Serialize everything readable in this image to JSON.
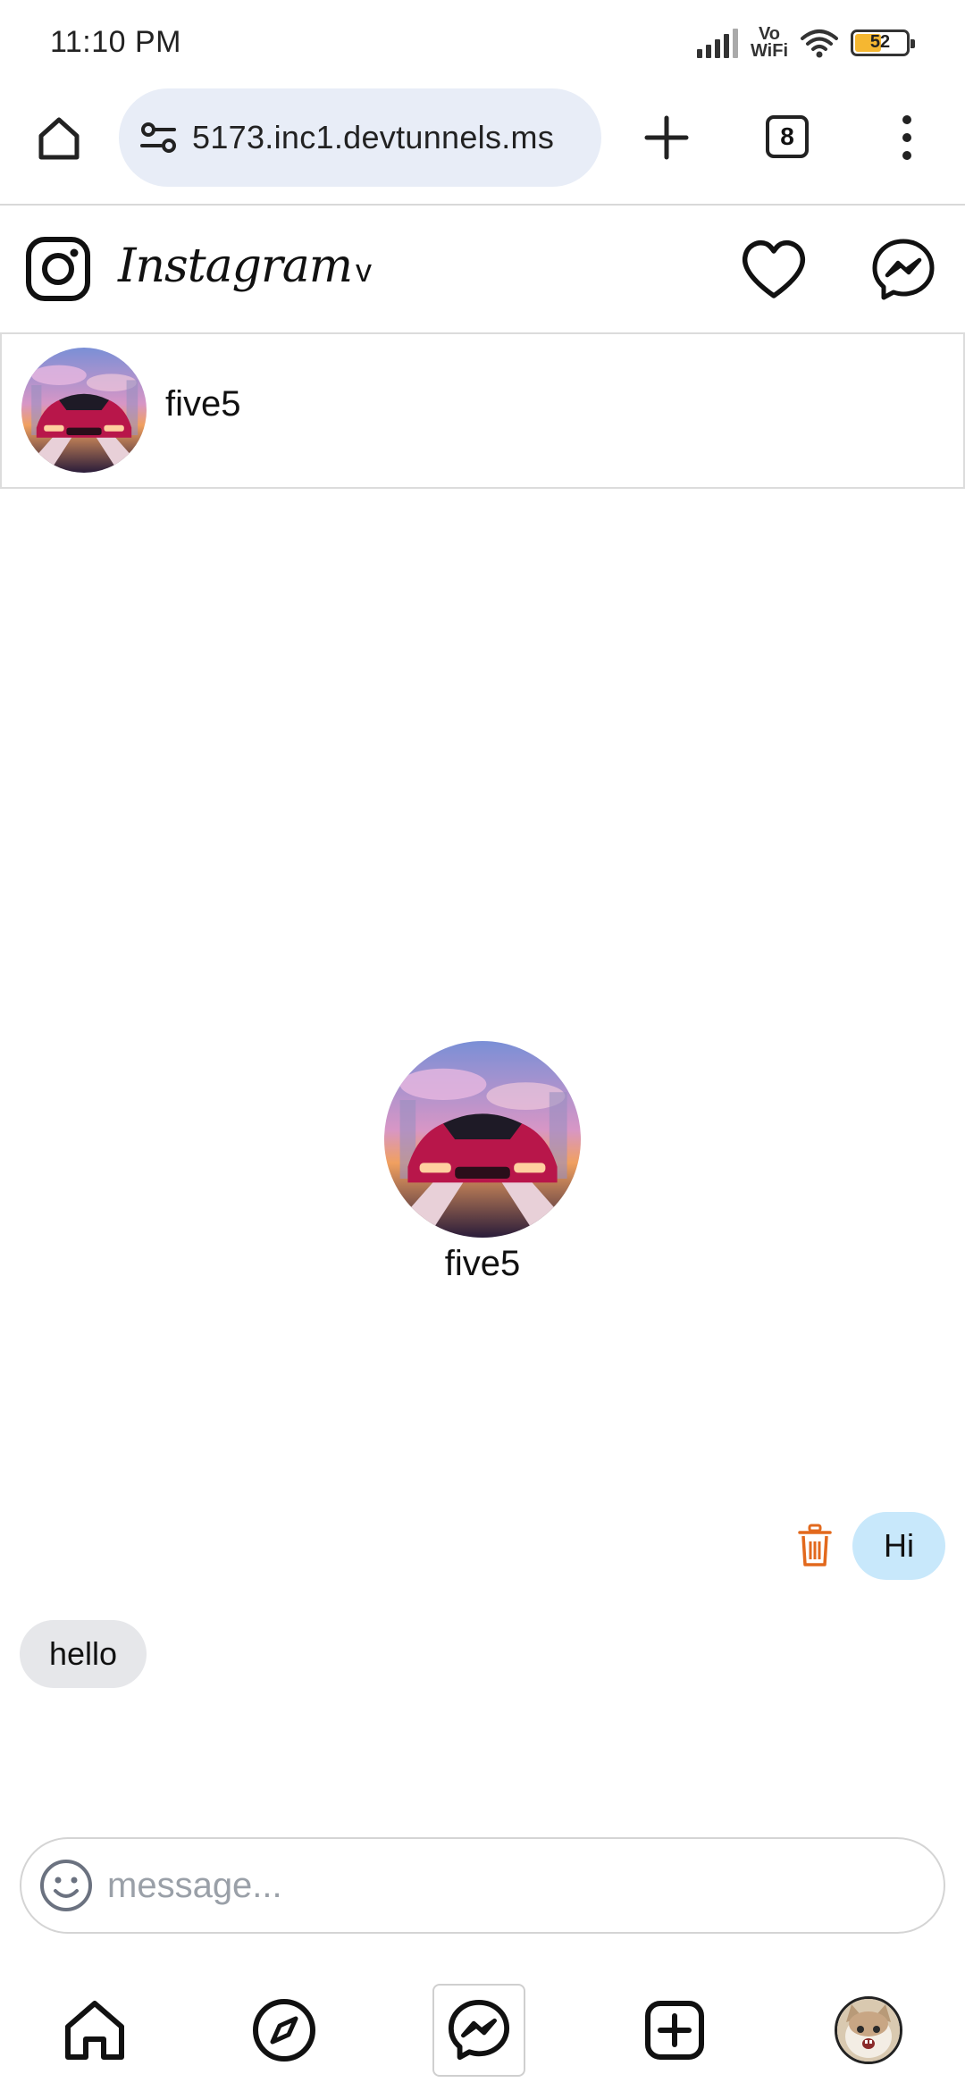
{
  "status_bar": {
    "time": "11:10 PM",
    "network_label": "Vo\nWiFi",
    "battery_percent": "52",
    "battery_level": 0.52
  },
  "browser": {
    "url": "5173.inc1.devtunnels.ms",
    "tab_count": "8",
    "icons": [
      "home-icon",
      "site-settings-icon",
      "new-tab-plus-icon",
      "tabs-icon",
      "more-menu-icon"
    ]
  },
  "app_header": {
    "brand": "Instagram",
    "account_switch_caret": "v",
    "icons": [
      "instagram-logo-icon",
      "heart-icon",
      "messenger-icon"
    ]
  },
  "chat": {
    "username": "five5",
    "profile_name": "five5",
    "messages": [
      {
        "direction": "outgoing",
        "text": "Hi"
      },
      {
        "direction": "incoming",
        "text": "hello"
      }
    ],
    "input_placeholder": "message...",
    "input_value": ""
  },
  "bottom_nav": {
    "items": [
      "home",
      "explore",
      "messages",
      "create",
      "profile"
    ],
    "active": "messages"
  },
  "colors": {
    "outgoing_bubble": "#c8e8fb",
    "incoming_bubble": "#e6e7ea",
    "url_pill": "#e8edf7",
    "trash_icon": "#e2691d",
    "battery_fill": "#f5b731"
  }
}
